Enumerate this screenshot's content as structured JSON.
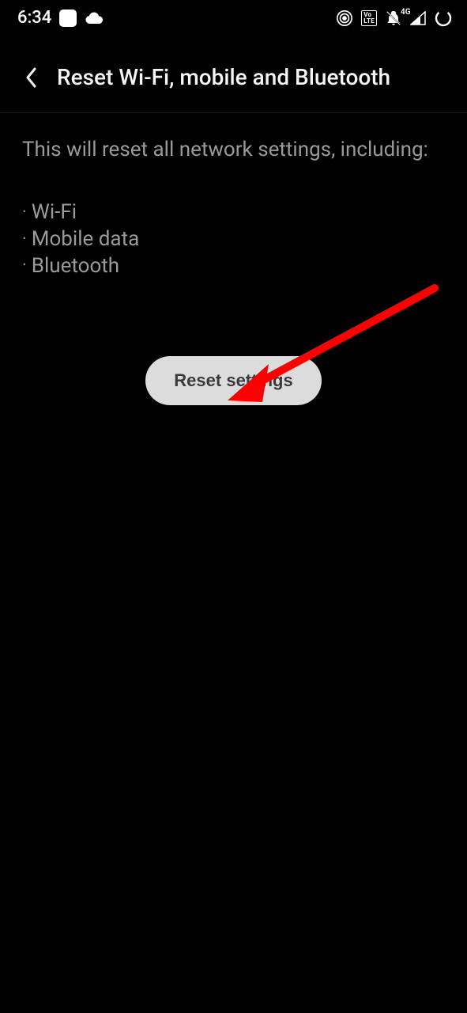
{
  "statusbar": {
    "time": "6:34",
    "network_label": "4G"
  },
  "header": {
    "title": "Reset Wi-Fi, mobile and Bluetooth"
  },
  "content": {
    "description": "This will reset all network settings, including:",
    "items": [
      "Wi-Fi",
      "Mobile data",
      "Bluetooth"
    ]
  },
  "button": {
    "reset_label": "Reset settings"
  }
}
